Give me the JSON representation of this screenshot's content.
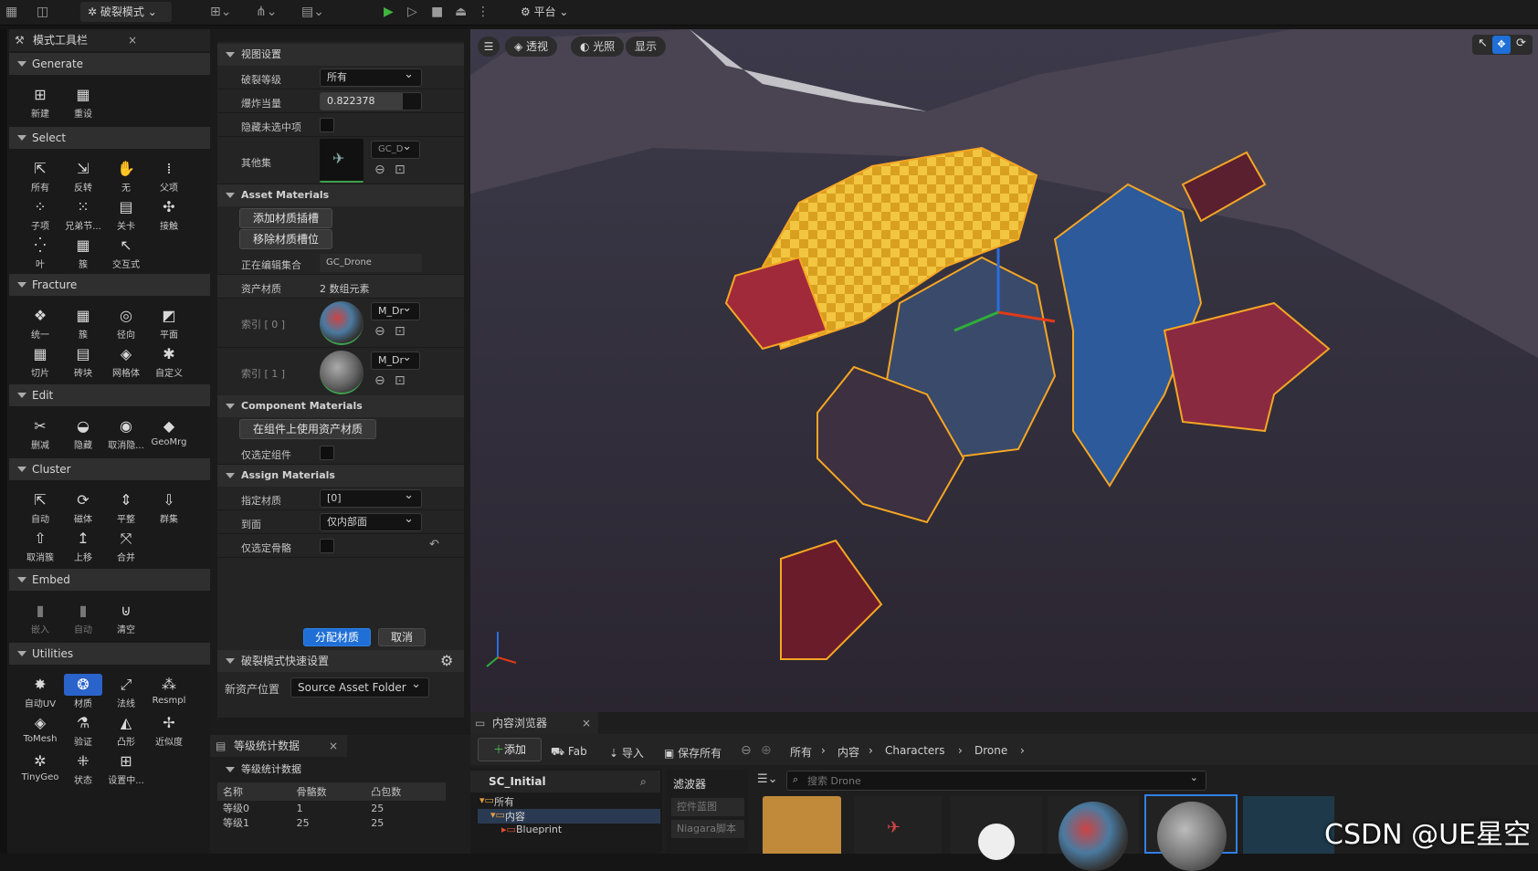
{
  "topbar": {
    "mode_label": "破裂模式",
    "platform_label": "平台"
  },
  "modes_panel": {
    "tab_title": "模式工具栏",
    "sections": [
      {
        "name": "Generate",
        "tools": [
          "新建",
          "重设"
        ]
      },
      {
        "name": "Select",
        "tools": [
          "所有",
          "反转",
          "无",
          "父项",
          "子项",
          "兄弟节...",
          "关卡",
          "接触",
          "叶",
          "簇",
          "交互式"
        ]
      },
      {
        "name": "Fracture",
        "tools": [
          "统一",
          "簇",
          "径向",
          "平面",
          "切片",
          "砖块",
          "网格体",
          "自定义"
        ]
      },
      {
        "name": "Edit",
        "tools": [
          "删减",
          "隐藏",
          "取消隐...",
          "GeoMrg"
        ]
      },
      {
        "name": "Cluster",
        "tools": [
          "自动",
          "磁体",
          "平整",
          "群集",
          "取消簇",
          "上移",
          "合并"
        ]
      },
      {
        "name": "Embed",
        "tools": [
          "嵌入",
          "自动",
          "清空"
        ]
      },
      {
        "name": "Utilities",
        "tools": [
          "自动UV",
          "材质",
          "法线",
          "Resmpl",
          "ToMesh",
          "验证",
          "凸形",
          "近似度",
          "TinyGeo",
          "状态",
          "设置中..."
        ]
      }
    ]
  },
  "props": {
    "view_settings": "视图设置",
    "fracture_level_label": "破裂等级",
    "fracture_level_value": "所有",
    "explode_label": "爆炸当量",
    "explode_value": "0.822378",
    "hide_unselected_label": "隐藏未选中项",
    "other_set_label": "其他集",
    "other_set_value": "GC_D",
    "asset_materials": "Asset Materials",
    "add_slot": "添加材质插槽",
    "remove_slot": "移除材质槽位",
    "editing_set_label": "正在编辑集合",
    "editing_set_value": "GC_Drone",
    "asset_mat_label": "资产材质",
    "asset_mat_count": "2 数组元素",
    "index0": "索引 [ 0 ]",
    "index1": "索引 [ 1 ]",
    "mat_name": "M_Dr",
    "component_materials": "Component Materials",
    "use_asset_mat": "在组件上使用资产材质",
    "only_selected_comp": "仅选定组件",
    "assign_materials": "Assign Materials",
    "assign_mat_label": "指定材质",
    "assign_mat_value": "[0]",
    "to_face_label": "到面",
    "to_face_value": "仅内部面",
    "only_selected_bones": "仅选定骨骼",
    "assign_btn": "分配材质",
    "cancel_btn": "取消",
    "quick_settings": "破裂模式快速设置",
    "new_asset_loc_label": "新资产位置",
    "new_asset_loc_value": "Source Asset Folder"
  },
  "stats": {
    "tab": "等级统计数据",
    "sub": "等级统计数据",
    "headers": [
      "名称",
      "骨骼数",
      "凸包数"
    ],
    "rows": [
      [
        "等级0",
        "1",
        "25"
      ],
      [
        "等级1",
        "25",
        "25"
      ]
    ]
  },
  "viewport": {
    "perspective": "透视",
    "lighting": "光照",
    "show": "显示"
  },
  "content_browser": {
    "tab": "内容浏览器",
    "add": "添加",
    "fab": "Fab",
    "import": "导入",
    "save_all": "保存所有",
    "breadcrumb": [
      "所有",
      "内容",
      "Characters",
      "Drone"
    ],
    "collection": "SC_Initial",
    "filters": "滤波器",
    "search_placeholder": "搜索 Drone",
    "tree": [
      "所有",
      "内容",
      "Blueprint"
    ],
    "filter_chips": [
      "控件蓝图",
      "Niagara脚本"
    ]
  },
  "watermark": "CSDN @UE星空",
  "colors": {
    "accent": "#2a63c9",
    "selection_outline": "#f5a623",
    "green_bar": "#3ea04d"
  }
}
